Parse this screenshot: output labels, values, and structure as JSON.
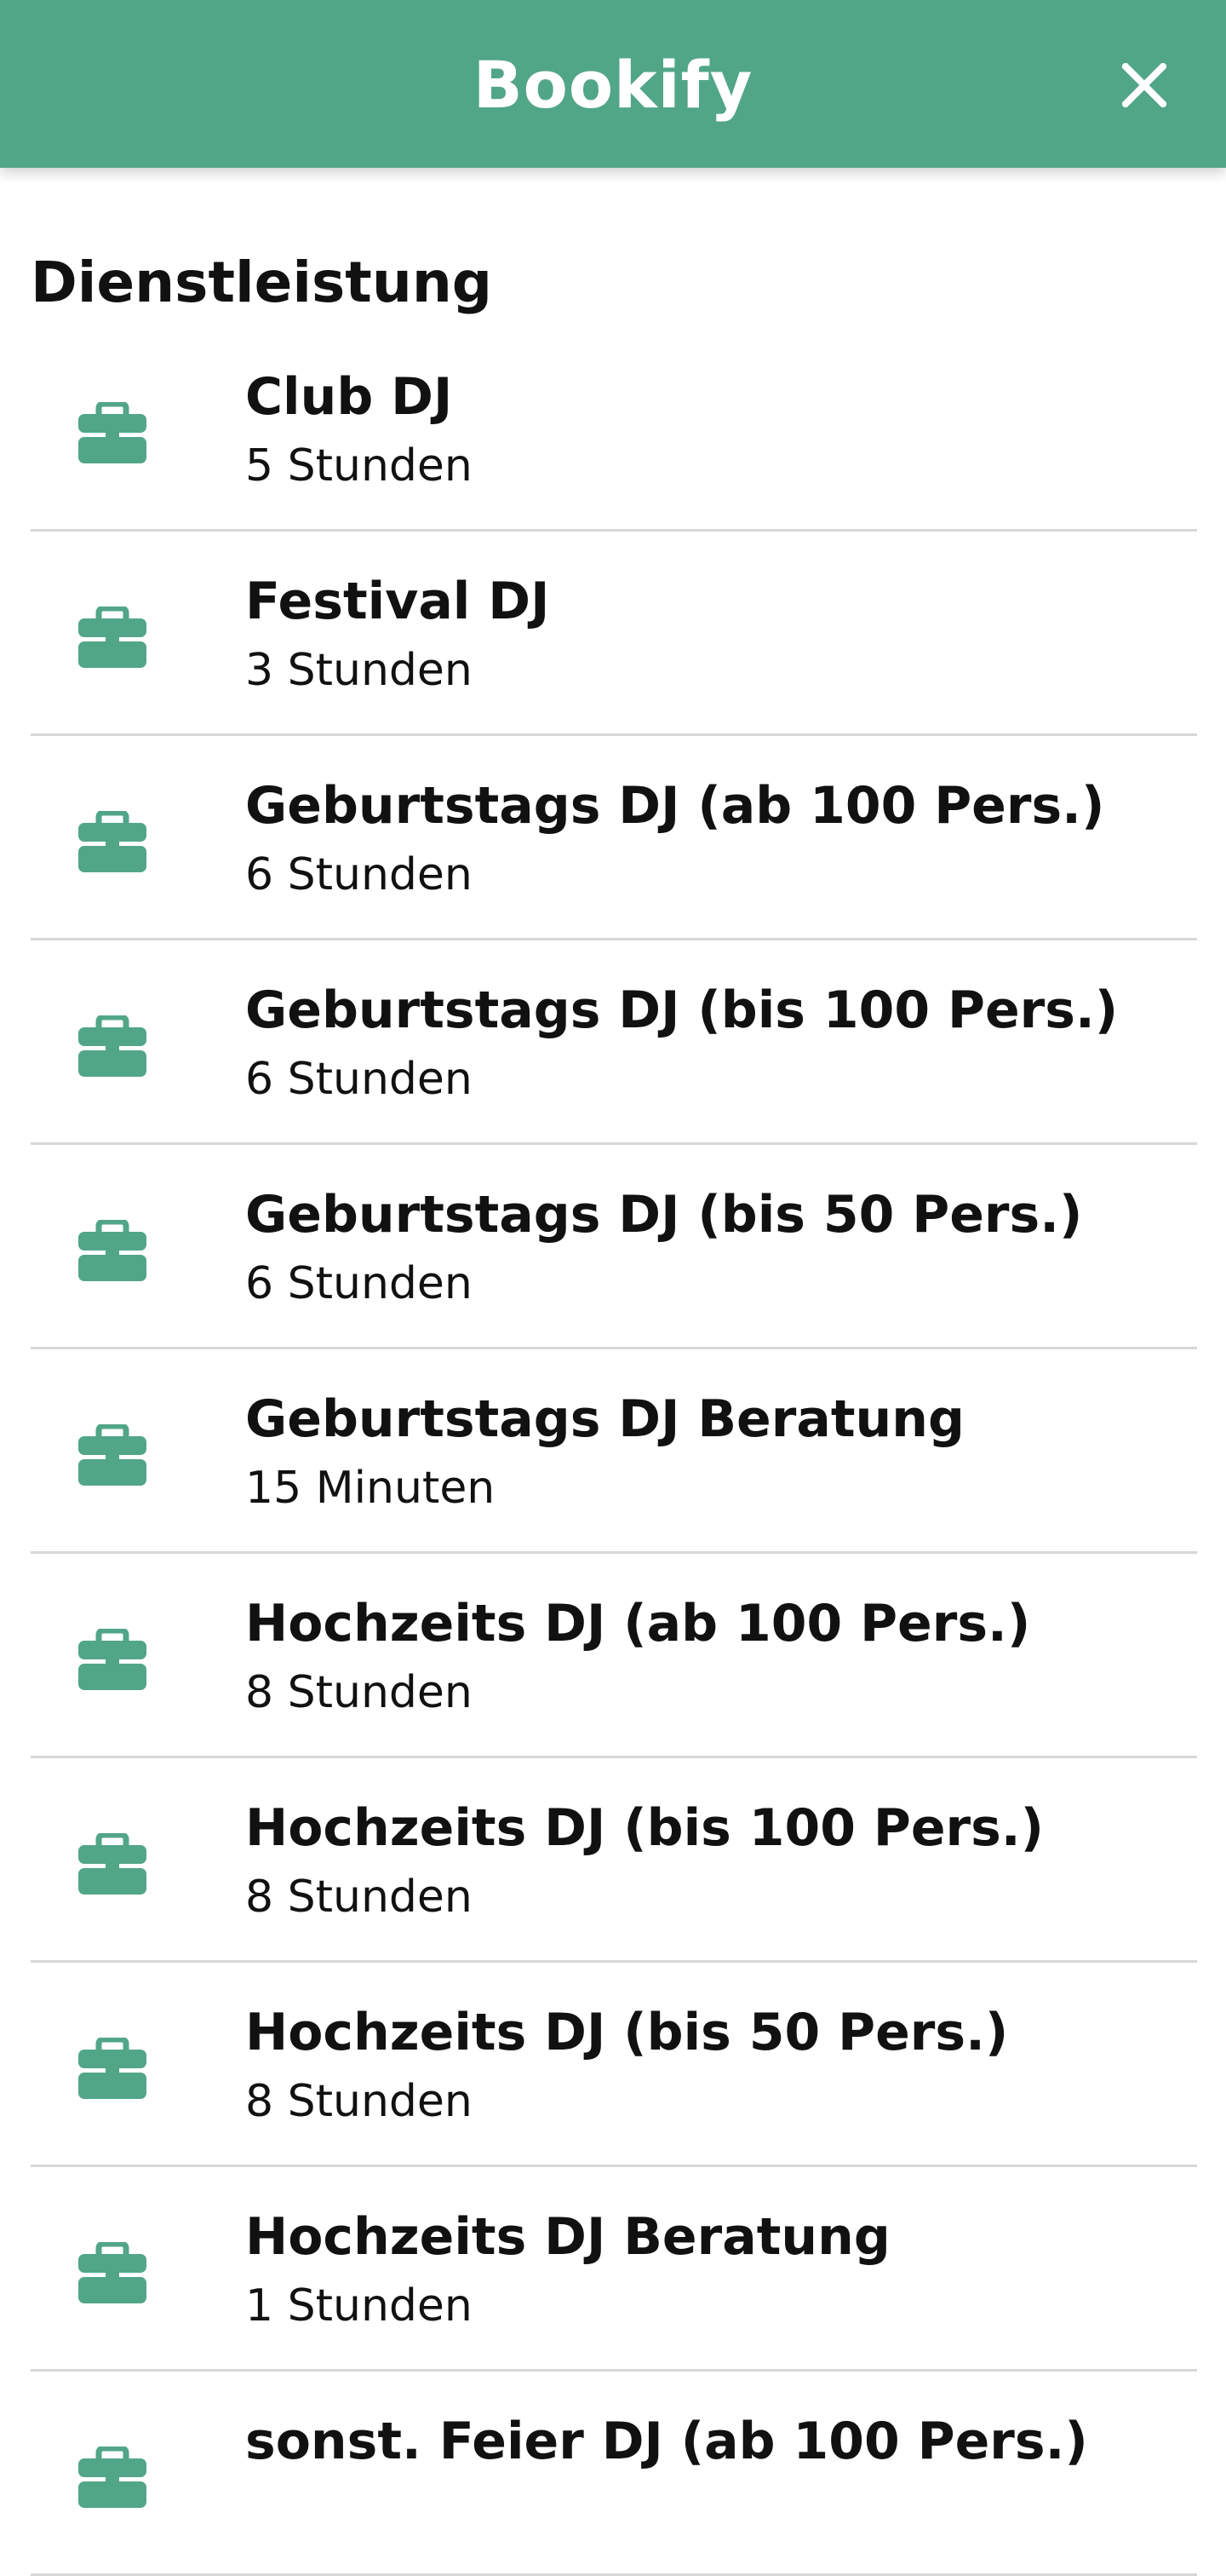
{
  "app": {
    "title": "Bookify",
    "accent_color": "#52a688",
    "close_icon": "close-icon"
  },
  "section": {
    "title": "Dienstleistung"
  },
  "services": [
    {
      "name": "Club DJ",
      "duration": "5 Stunden",
      "icon": "briefcase-icon"
    },
    {
      "name": "Festival DJ",
      "duration": "3 Stunden",
      "icon": "briefcase-icon"
    },
    {
      "name": "Geburtstags DJ (ab 100 Pers.)",
      "duration": "6 Stunden",
      "icon": "briefcase-icon"
    },
    {
      "name": "Geburtstags DJ (bis 100 Pers.)",
      "duration": "6 Stunden",
      "icon": "briefcase-icon"
    },
    {
      "name": "Geburtstags DJ (bis 50 Pers.)",
      "duration": "6 Stunden",
      "icon": "briefcase-icon"
    },
    {
      "name": "Geburtstags DJ Beratung",
      "duration": "15 Minuten",
      "icon": "briefcase-icon"
    },
    {
      "name": "Hochzeits DJ (ab 100 Pers.)",
      "duration": "8 Stunden",
      "icon": "briefcase-icon"
    },
    {
      "name": "Hochzeits DJ (bis 100 Pers.)",
      "duration": "8 Stunden",
      "icon": "briefcase-icon"
    },
    {
      "name": "Hochzeits DJ (bis 50 Pers.)",
      "duration": "8 Stunden",
      "icon": "briefcase-icon"
    },
    {
      "name": "Hochzeits DJ Beratung",
      "duration": "1 Stunden",
      "icon": "briefcase-icon"
    },
    {
      "name": "sonst. Feier DJ (ab 100 Pers.)",
      "duration": "",
      "icon": "briefcase-icon"
    }
  ]
}
